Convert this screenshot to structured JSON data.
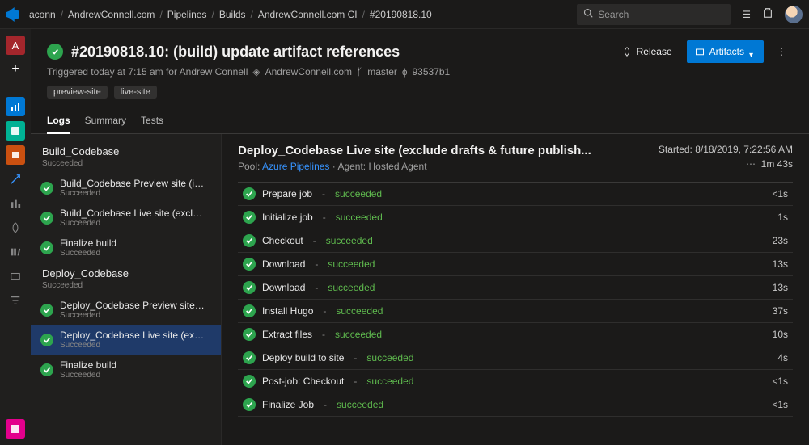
{
  "breadcrumbs": [
    "aconn",
    "AndrewConnell.com",
    "Pipelines",
    "Builds",
    "AndrewConnell.com CI",
    "#20190818.10"
  ],
  "search": {
    "placeholder": "Search"
  },
  "actions": {
    "release": "Release",
    "artifacts": "Artifacts"
  },
  "title": "#20190818.10: (build) update artifact references",
  "subtitle": {
    "prefix": "Triggered today at 7:15 am for Andrew Connell",
    "repo": "AndrewConnell.com",
    "branch": "master",
    "commit": "93537b1"
  },
  "tags": [
    "preview-site",
    "live-site"
  ],
  "tabs": [
    "Logs",
    "Summary",
    "Tests"
  ],
  "activeTab": 0,
  "stages": [
    {
      "name": "Build_Codebase",
      "status": "Succeeded",
      "jobs": [
        {
          "name": "Build_Codebase Preview site (incl...",
          "status": "Succeeded"
        },
        {
          "name": "Build_Codebase Live site (exclude ...",
          "status": "Succeeded"
        },
        {
          "name": "Finalize build",
          "status": "Succeeded"
        }
      ]
    },
    {
      "name": "Deploy_Codebase",
      "status": "Succeeded",
      "jobs": [
        {
          "name": "Deploy_Codebase Preview site (in...",
          "status": "Succeeded"
        },
        {
          "name": "Deploy_Codebase Live site (exclu...",
          "status": "Succeeded",
          "selected": true
        },
        {
          "name": "Finalize build",
          "status": "Succeeded"
        }
      ]
    }
  ],
  "details": {
    "title": "Deploy_Codebase Live site (exclude drafts & future publish...",
    "poolLabel": "Pool:",
    "poolName": "Azure Pipelines",
    "agentLabel": "Agent:",
    "agentName": "Hosted Agent",
    "startedLabel": "Started:",
    "started": "8/18/2019, 7:22:56 AM",
    "duration": "1m 43s"
  },
  "steps": [
    {
      "name": "Prepare job",
      "status": "succeeded",
      "duration": "<1s"
    },
    {
      "name": "Initialize job",
      "status": "succeeded",
      "duration": "1s"
    },
    {
      "name": "Checkout",
      "status": "succeeded",
      "duration": "23s"
    },
    {
      "name": "Download",
      "status": "succeeded",
      "duration": "13s"
    },
    {
      "name": "Download",
      "status": "succeeded",
      "duration": "13s"
    },
    {
      "name": "Install Hugo",
      "status": "succeeded",
      "duration": "37s"
    },
    {
      "name": "Extract files",
      "status": "succeeded",
      "duration": "10s"
    },
    {
      "name": "Deploy build to site",
      "status": "succeeded",
      "duration": "4s"
    },
    {
      "name": "Post-job: Checkout",
      "status": "succeeded",
      "duration": "<1s"
    },
    {
      "name": "Finalize Job",
      "status": "succeeded",
      "duration": "<1s"
    }
  ]
}
